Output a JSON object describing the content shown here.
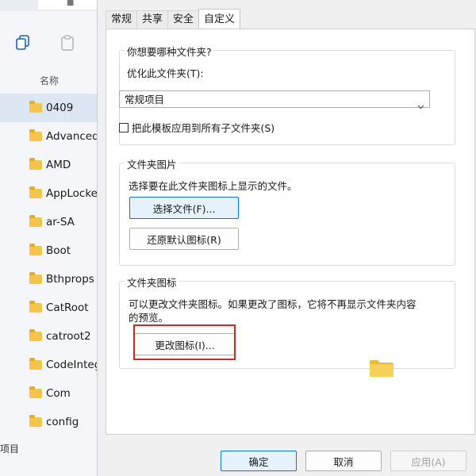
{
  "explorer": {
    "tab_glyph": "■",
    "column_header": "名称",
    "files": [
      {
        "name": "0409",
        "selected": true
      },
      {
        "name": "Advanced",
        "selected": false
      },
      {
        "name": "AMD",
        "selected": false
      },
      {
        "name": "AppLocke",
        "selected": false
      },
      {
        "name": "ar-SA",
        "selected": false
      },
      {
        "name": "Boot",
        "selected": false
      },
      {
        "name": "Bthprops",
        "selected": false
      },
      {
        "name": "CatRoot",
        "selected": false
      },
      {
        "name": "catroot2",
        "selected": false
      },
      {
        "name": "CodeInteg",
        "selected": false
      },
      {
        "name": "Com",
        "selected": false
      },
      {
        "name": "config",
        "selected": false
      }
    ],
    "status_text": "项目"
  },
  "dialog": {
    "tabs": [
      {
        "label": "常规",
        "active": false
      },
      {
        "label": "共享",
        "active": false
      },
      {
        "label": "安全",
        "active": false
      },
      {
        "label": "自定义",
        "active": true
      }
    ],
    "folder_type_group": {
      "title": "你想要哪种文件夹?",
      "optimize_label": "优化此文件夹(T):",
      "optimize_value": "常规项目",
      "apply_template_label": "把此模板应用到所有子文件夹(S)",
      "apply_template_checked": false
    },
    "folder_picture_group": {
      "title": "文件夹图片",
      "description": "选择要在此文件夹图标上显示的文件。",
      "choose_file_label": "选择文件(F)...",
      "restore_default_label": "还原默认图标(R)"
    },
    "folder_icon_group": {
      "title": "文件夹图标",
      "description_line1": "可以更改文件夹图标。如果更改了图标，它将不再显示文件夹内容",
      "description_line2": "的预览。",
      "change_icon_label": "更改图标(I)..."
    },
    "buttons": {
      "ok": "确定",
      "cancel": "取消",
      "apply": "应用(A)"
    }
  },
  "colors": {
    "folder": "#f3c54a",
    "highlight": "#e02020",
    "focus_border": "#0078d7",
    "selected_row": "#dde7f3"
  },
  "icons": {
    "copy": "copy-icon",
    "paste": "paste-icon",
    "folder": "folder-icon",
    "chevron": "chevron-down-icon"
  }
}
